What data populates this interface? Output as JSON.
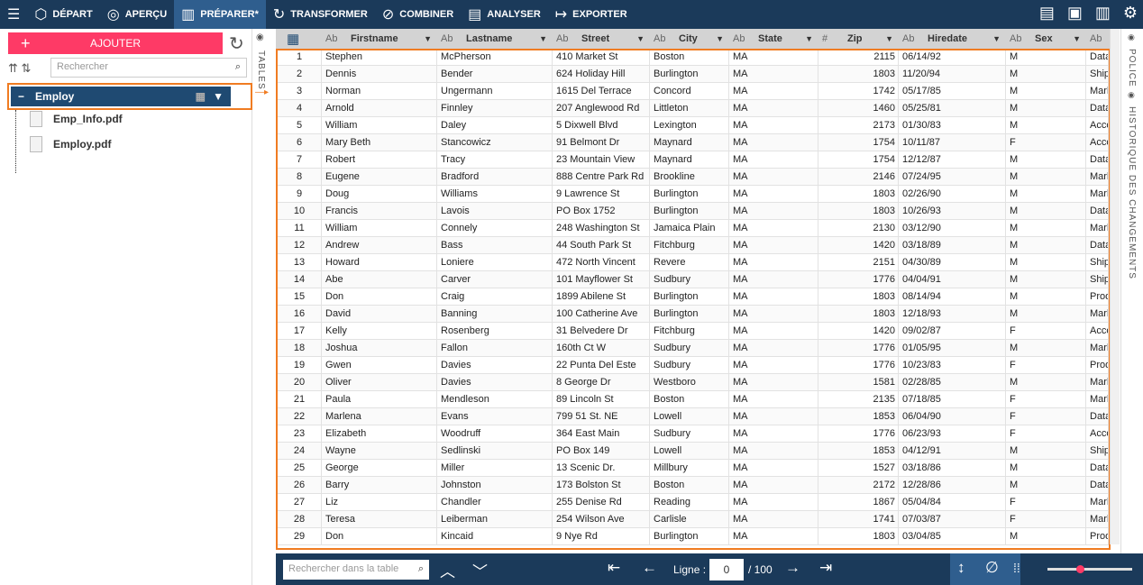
{
  "topbar": {
    "items": [
      {
        "label": "DÉPART",
        "icon": "cube-icon"
      },
      {
        "label": "APERÇU",
        "icon": "eye-icon"
      },
      {
        "label": "PRÉPARER*",
        "icon": "prepare-icon",
        "active": true
      },
      {
        "label": "TRANSFORMER",
        "icon": "transform-icon"
      },
      {
        "label": "COMBINER",
        "icon": "combine-icon"
      },
      {
        "label": "ANALYSER",
        "icon": "clipboard-icon"
      },
      {
        "label": "EXPORTER",
        "icon": "export-icon"
      }
    ]
  },
  "sidebar": {
    "add_label": "AJOUTER",
    "search_placeholder": "Rechercher",
    "table_name": "Employ",
    "files": [
      "Emp_Info.pdf",
      "Employ.pdf"
    ],
    "tables_tab": "TABLES"
  },
  "right_tabs": {
    "police": "POLICE",
    "history": "HISTORIQUE DES CHANGEMENTS"
  },
  "columns": [
    {
      "type": "Ab",
      "name": "Firstname"
    },
    {
      "type": "Ab",
      "name": "Lastname"
    },
    {
      "type": "Ab",
      "name": "Street"
    },
    {
      "type": "Ab",
      "name": "City"
    },
    {
      "type": "Ab",
      "name": "State"
    },
    {
      "type": "#",
      "name": "Zip"
    },
    {
      "type": "Ab",
      "name": "Hiredate"
    },
    {
      "type": "Ab",
      "name": "Sex"
    },
    {
      "type": "Ab",
      "name": ""
    }
  ],
  "rows": [
    [
      "1",
      "Stephen",
      "McPherson",
      "410 Market St",
      "Boston",
      "MA",
      "2115",
      "06/14/92",
      "M",
      "Data"
    ],
    [
      "2",
      "Dennis",
      "Bender",
      "624 Holiday Hill",
      "Burlington",
      "MA",
      "1803",
      "11/20/94",
      "M",
      "Shipp"
    ],
    [
      "3",
      "Norman",
      "Ungermann",
      "1615 Del Terrace",
      "Concord",
      "MA",
      "1742",
      "05/17/85",
      "M",
      "Mark"
    ],
    [
      "4",
      "Arnold",
      "Finnley",
      "207 Anglewood Rd",
      "Littleton",
      "MA",
      "1460",
      "05/25/81",
      "M",
      "Data"
    ],
    [
      "5",
      "William",
      "Daley",
      "5 Dixwell Blvd",
      "Lexington",
      "MA",
      "2173",
      "01/30/83",
      "M",
      "Acco"
    ],
    [
      "6",
      "Mary Beth",
      "Stancowicz",
      "91 Belmont Dr",
      "Maynard",
      "MA",
      "1754",
      "10/11/87",
      "F",
      "Acco"
    ],
    [
      "7",
      "Robert",
      "Tracy",
      "23 Mountain View",
      "Maynard",
      "MA",
      "1754",
      "12/12/87",
      "M",
      "Data"
    ],
    [
      "8",
      "Eugene",
      "Bradford",
      "888 Centre Park Rd",
      "Brookline",
      "MA",
      "2146",
      "07/24/95",
      "M",
      "Mark"
    ],
    [
      "9",
      "Doug",
      "Williams",
      "9 Lawrence St",
      "Burlington",
      "MA",
      "1803",
      "02/26/90",
      "M",
      "Mark"
    ],
    [
      "10",
      "Francis",
      "Lavois",
      "PO Box 1752",
      "Burlington",
      "MA",
      "1803",
      "10/26/93",
      "M",
      "Data"
    ],
    [
      "11",
      "William",
      "Connely",
      "248 Washington St",
      "Jamaica Plain",
      "MA",
      "2130",
      "03/12/90",
      "M",
      "Mark"
    ],
    [
      "12",
      "Andrew",
      "Bass",
      "44 South Park St",
      "Fitchburg",
      "MA",
      "1420",
      "03/18/89",
      "M",
      "Data"
    ],
    [
      "13",
      "Howard",
      "Loniere",
      "472 North Vincent",
      "Revere",
      "MA",
      "2151",
      "04/30/89",
      "M",
      "Shipp"
    ],
    [
      "14",
      "Abe",
      "Carver",
      "101 Mayflower St",
      "Sudbury",
      "MA",
      "1776",
      "04/04/91",
      "M",
      "Shipp"
    ],
    [
      "15",
      "Don",
      "Craig",
      "1899 Abilene St",
      "Burlington",
      "MA",
      "1803",
      "08/14/94",
      "M",
      "Prod"
    ],
    [
      "16",
      "David",
      "Banning",
      "100 Catherine Ave",
      "Burlington",
      "MA",
      "1803",
      "12/18/93",
      "M",
      "Mark"
    ],
    [
      "17",
      "Kelly",
      "Rosenberg",
      "31 Belvedere Dr",
      "Fitchburg",
      "MA",
      "1420",
      "09/02/87",
      "F",
      "Acco"
    ],
    [
      "18",
      "Joshua",
      "Fallon",
      "160th Ct W",
      "Sudbury",
      "MA",
      "1776",
      "01/05/95",
      "M",
      "Mark"
    ],
    [
      "19",
      "Gwen",
      "Davies",
      "22 Punta Del Este",
      "Sudbury",
      "MA",
      "1776",
      "10/23/83",
      "F",
      "Prod"
    ],
    [
      "20",
      "Oliver",
      "Davies",
      "8 George Dr",
      "Westboro",
      "MA",
      "1581",
      "02/28/85",
      "M",
      "Mark"
    ],
    [
      "21",
      "Paula",
      "Mendleson",
      "89 Lincoln St",
      "Boston",
      "MA",
      "2135",
      "07/18/85",
      "F",
      "Mark"
    ],
    [
      "22",
      "Marlena",
      "Evans",
      "799 51 St. NE",
      "Lowell",
      "MA",
      "1853",
      "06/04/90",
      "F",
      "Data"
    ],
    [
      "23",
      "Elizabeth",
      "Woodruff",
      "364 East Main",
      "Sudbury",
      "MA",
      "1776",
      "06/23/93",
      "F",
      "Acco"
    ],
    [
      "24",
      "Wayne",
      "Sedlinski",
      "PO Box 149",
      "Lowell",
      "MA",
      "1853",
      "04/12/91",
      "M",
      "Shipp"
    ],
    [
      "25",
      "George",
      "Miller",
      "13 Scenic Dr.",
      "Millbury",
      "MA",
      "1527",
      "03/18/86",
      "M",
      "Data"
    ],
    [
      "26",
      "Barry",
      "Johnston",
      "173 Bolston St",
      "Boston",
      "MA",
      "2172",
      "12/28/86",
      "M",
      "Data"
    ],
    [
      "27",
      "Liz",
      "Chandler",
      "255 Denise Rd",
      "Reading",
      "MA",
      "1867",
      "05/04/84",
      "F",
      "Mark"
    ],
    [
      "28",
      "Teresa",
      "Leiberman",
      "254 Wilson Ave",
      "Carlisle",
      "MA",
      "1741",
      "07/03/87",
      "F",
      "Mark"
    ],
    [
      "29",
      "Don",
      "Kincaid",
      "9 Nye Rd",
      "Burlington",
      "MA",
      "1803",
      "03/04/85",
      "M",
      "Prod"
    ]
  ],
  "bottom": {
    "search_placeholder": "Rechercher dans la table",
    "line_label": "Ligne :",
    "line_value": "0",
    "line_total": "/ 100",
    "zoom_level": 0.38
  },
  "colors": {
    "topbar": "#1b3a5a",
    "accent": "#f07c22",
    "add": "#fe3a66"
  }
}
